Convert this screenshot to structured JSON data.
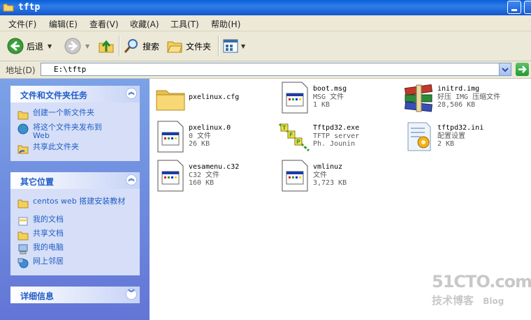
{
  "window": {
    "title": "tftp"
  },
  "menu": [
    "文件(F)",
    "编辑(E)",
    "查看(V)",
    "收藏(A)",
    "工具(T)",
    "帮助(H)"
  ],
  "toolbar": {
    "back": "后退",
    "search": "搜索",
    "folders": "文件夹"
  },
  "address": {
    "label": "地址(D)",
    "value": "E:\\tftp"
  },
  "tasks": {
    "title": "文件和文件夹任务",
    "items": [
      "创建一个新文件夹",
      "将这个文件夹发布到 Web",
      "共享此文件夹"
    ]
  },
  "places": {
    "title": "其它位置",
    "items": [
      "centos web 搭建安装教材",
      "我的文档",
      "共享文档",
      "我的电脑",
      "网上邻居"
    ]
  },
  "details": {
    "title": "详细信息"
  },
  "files": [
    {
      "name": "pxelinux.cfg",
      "line2": "",
      "line3": "",
      "icon": "folder-icon"
    },
    {
      "name": "boot.msg",
      "line2": "MSG 文件",
      "line3": "1 KB",
      "icon": "document-icon"
    },
    {
      "name": "initrd.img",
      "line2": "好压 IMG 压缩文件",
      "line3": "28,506 KB",
      "icon": "archive-icon"
    },
    {
      "name": "pxelinux.0",
      "line2": "0 文件",
      "line3": "26 KB",
      "icon": "document-icon"
    },
    {
      "name": "Tftpd32.exe",
      "line2": "TFTP server",
      "line3": "Ph. Jounin",
      "icon": "tftp-app-icon"
    },
    {
      "name": "tftpd32.ini",
      "line2": "配置设置",
      "line3": "2 KB",
      "icon": "settings-file-icon"
    },
    {
      "name": "vesamenu.c32",
      "line2": "C32 文件",
      "line3": "160 KB",
      "icon": "document-icon"
    },
    {
      "name": "vmlinuz",
      "line2": "文件",
      "line3": "3,723 KB",
      "icon": "document-icon"
    }
  ],
  "watermark": {
    "line1": "51CTO.com",
    "line2": "技术博客",
    "line3": "Blog"
  }
}
